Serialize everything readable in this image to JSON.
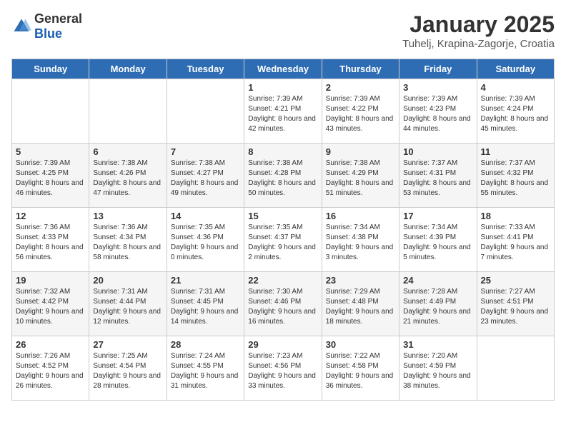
{
  "header": {
    "logo": {
      "general": "General",
      "blue": "Blue"
    },
    "title": "January 2025",
    "subtitle": "Tuhelj, Krapina-Zagorje, Croatia"
  },
  "weekdays": [
    "Sunday",
    "Monday",
    "Tuesday",
    "Wednesday",
    "Thursday",
    "Friday",
    "Saturday"
  ],
  "weeks": [
    [
      {
        "day": "",
        "sunrise": "",
        "sunset": "",
        "daylight": ""
      },
      {
        "day": "",
        "sunrise": "",
        "sunset": "",
        "daylight": ""
      },
      {
        "day": "",
        "sunrise": "",
        "sunset": "",
        "daylight": ""
      },
      {
        "day": "1",
        "sunrise": "Sunrise: 7:39 AM",
        "sunset": "Sunset: 4:21 PM",
        "daylight": "Daylight: 8 hours and 42 minutes."
      },
      {
        "day": "2",
        "sunrise": "Sunrise: 7:39 AM",
        "sunset": "Sunset: 4:22 PM",
        "daylight": "Daylight: 8 hours and 43 minutes."
      },
      {
        "day": "3",
        "sunrise": "Sunrise: 7:39 AM",
        "sunset": "Sunset: 4:23 PM",
        "daylight": "Daylight: 8 hours and 44 minutes."
      },
      {
        "day": "4",
        "sunrise": "Sunrise: 7:39 AM",
        "sunset": "Sunset: 4:24 PM",
        "daylight": "Daylight: 8 hours and 45 minutes."
      }
    ],
    [
      {
        "day": "5",
        "sunrise": "Sunrise: 7:39 AM",
        "sunset": "Sunset: 4:25 PM",
        "daylight": "Daylight: 8 hours and 46 minutes."
      },
      {
        "day": "6",
        "sunrise": "Sunrise: 7:38 AM",
        "sunset": "Sunset: 4:26 PM",
        "daylight": "Daylight: 8 hours and 47 minutes."
      },
      {
        "day": "7",
        "sunrise": "Sunrise: 7:38 AM",
        "sunset": "Sunset: 4:27 PM",
        "daylight": "Daylight: 8 hours and 49 minutes."
      },
      {
        "day": "8",
        "sunrise": "Sunrise: 7:38 AM",
        "sunset": "Sunset: 4:28 PM",
        "daylight": "Daylight: 8 hours and 50 minutes."
      },
      {
        "day": "9",
        "sunrise": "Sunrise: 7:38 AM",
        "sunset": "Sunset: 4:29 PM",
        "daylight": "Daylight: 8 hours and 51 minutes."
      },
      {
        "day": "10",
        "sunrise": "Sunrise: 7:37 AM",
        "sunset": "Sunset: 4:31 PM",
        "daylight": "Daylight: 8 hours and 53 minutes."
      },
      {
        "day": "11",
        "sunrise": "Sunrise: 7:37 AM",
        "sunset": "Sunset: 4:32 PM",
        "daylight": "Daylight: 8 hours and 55 minutes."
      }
    ],
    [
      {
        "day": "12",
        "sunrise": "Sunrise: 7:36 AM",
        "sunset": "Sunset: 4:33 PM",
        "daylight": "Daylight: 8 hours and 56 minutes."
      },
      {
        "day": "13",
        "sunrise": "Sunrise: 7:36 AM",
        "sunset": "Sunset: 4:34 PM",
        "daylight": "Daylight: 8 hours and 58 minutes."
      },
      {
        "day": "14",
        "sunrise": "Sunrise: 7:35 AM",
        "sunset": "Sunset: 4:36 PM",
        "daylight": "Daylight: 9 hours and 0 minutes."
      },
      {
        "day": "15",
        "sunrise": "Sunrise: 7:35 AM",
        "sunset": "Sunset: 4:37 PM",
        "daylight": "Daylight: 9 hours and 2 minutes."
      },
      {
        "day": "16",
        "sunrise": "Sunrise: 7:34 AM",
        "sunset": "Sunset: 4:38 PM",
        "daylight": "Daylight: 9 hours and 3 minutes."
      },
      {
        "day": "17",
        "sunrise": "Sunrise: 7:34 AM",
        "sunset": "Sunset: 4:39 PM",
        "daylight": "Daylight: 9 hours and 5 minutes."
      },
      {
        "day": "18",
        "sunrise": "Sunrise: 7:33 AM",
        "sunset": "Sunset: 4:41 PM",
        "daylight": "Daylight: 9 hours and 7 minutes."
      }
    ],
    [
      {
        "day": "19",
        "sunrise": "Sunrise: 7:32 AM",
        "sunset": "Sunset: 4:42 PM",
        "daylight": "Daylight: 9 hours and 10 minutes."
      },
      {
        "day": "20",
        "sunrise": "Sunrise: 7:31 AM",
        "sunset": "Sunset: 4:44 PM",
        "daylight": "Daylight: 9 hours and 12 minutes."
      },
      {
        "day": "21",
        "sunrise": "Sunrise: 7:31 AM",
        "sunset": "Sunset: 4:45 PM",
        "daylight": "Daylight: 9 hours and 14 minutes."
      },
      {
        "day": "22",
        "sunrise": "Sunrise: 7:30 AM",
        "sunset": "Sunset: 4:46 PM",
        "daylight": "Daylight: 9 hours and 16 minutes."
      },
      {
        "day": "23",
        "sunrise": "Sunrise: 7:29 AM",
        "sunset": "Sunset: 4:48 PM",
        "daylight": "Daylight: 9 hours and 18 minutes."
      },
      {
        "day": "24",
        "sunrise": "Sunrise: 7:28 AM",
        "sunset": "Sunset: 4:49 PM",
        "daylight": "Daylight: 9 hours and 21 minutes."
      },
      {
        "day": "25",
        "sunrise": "Sunrise: 7:27 AM",
        "sunset": "Sunset: 4:51 PM",
        "daylight": "Daylight: 9 hours and 23 minutes."
      }
    ],
    [
      {
        "day": "26",
        "sunrise": "Sunrise: 7:26 AM",
        "sunset": "Sunset: 4:52 PM",
        "daylight": "Daylight: 9 hours and 26 minutes."
      },
      {
        "day": "27",
        "sunrise": "Sunrise: 7:25 AM",
        "sunset": "Sunset: 4:54 PM",
        "daylight": "Daylight: 9 hours and 28 minutes."
      },
      {
        "day": "28",
        "sunrise": "Sunrise: 7:24 AM",
        "sunset": "Sunset: 4:55 PM",
        "daylight": "Daylight: 9 hours and 31 minutes."
      },
      {
        "day": "29",
        "sunrise": "Sunrise: 7:23 AM",
        "sunset": "Sunset: 4:56 PM",
        "daylight": "Daylight: 9 hours and 33 minutes."
      },
      {
        "day": "30",
        "sunrise": "Sunrise: 7:22 AM",
        "sunset": "Sunset: 4:58 PM",
        "daylight": "Daylight: 9 hours and 36 minutes."
      },
      {
        "day": "31",
        "sunrise": "Sunrise: 7:20 AM",
        "sunset": "Sunset: 4:59 PM",
        "daylight": "Daylight: 9 hours and 38 minutes."
      },
      {
        "day": "",
        "sunrise": "",
        "sunset": "",
        "daylight": ""
      }
    ]
  ]
}
